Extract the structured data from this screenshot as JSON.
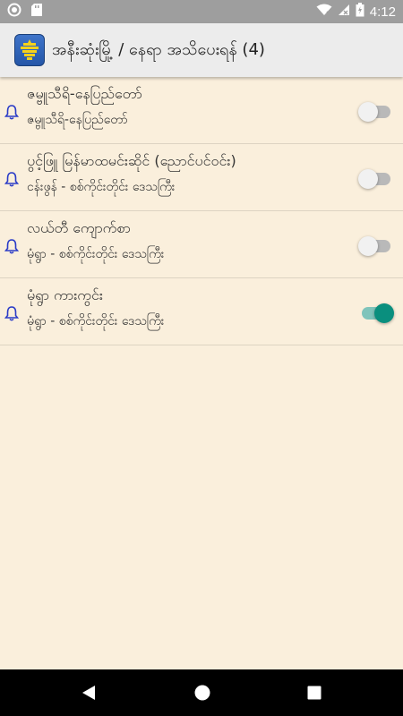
{
  "status_bar": {
    "time": "4:12",
    "icons": [
      "circle-icon",
      "sd-card-icon",
      "wifi-icon",
      "signal-icon",
      "battery-icon"
    ]
  },
  "app_bar": {
    "title": "အနီးဆုံးမြို့ / နေရာ အသိပေးရန် (4)",
    "icon": "app-logo-icon"
  },
  "items": [
    {
      "title": "ဇမ္ဗူသီရိ-နေပြည်တော်",
      "subtitle": "ဇမ္ဗူသီရိ-နေပြည်တော်",
      "enabled": false
    },
    {
      "title": "ပွင့်ဖြူ မြန်မာထမင်းဆိုင် (ညောင်ပင်ဝင်း)",
      "subtitle": "ငန်းဖွန် - စစ်ကိုင်းတိုင်း ဒေသကြီး",
      "enabled": false
    },
    {
      "title": "လယ်တီ ကျောက်စာ",
      "subtitle": "မုံရွာ - စစ်ကိုင်းတိုင်း ဒေသကြီး",
      "enabled": false
    },
    {
      "title": "မုံရွာ ကားကွင်း",
      "subtitle": "မုံရွာ - စစ်ကိုင်းတိုင်း ဒေသကြီး",
      "enabled": true
    }
  ],
  "colors": {
    "background": "#faefdc",
    "accent": "#0a8f7e",
    "bell": "#2b3cc7"
  }
}
